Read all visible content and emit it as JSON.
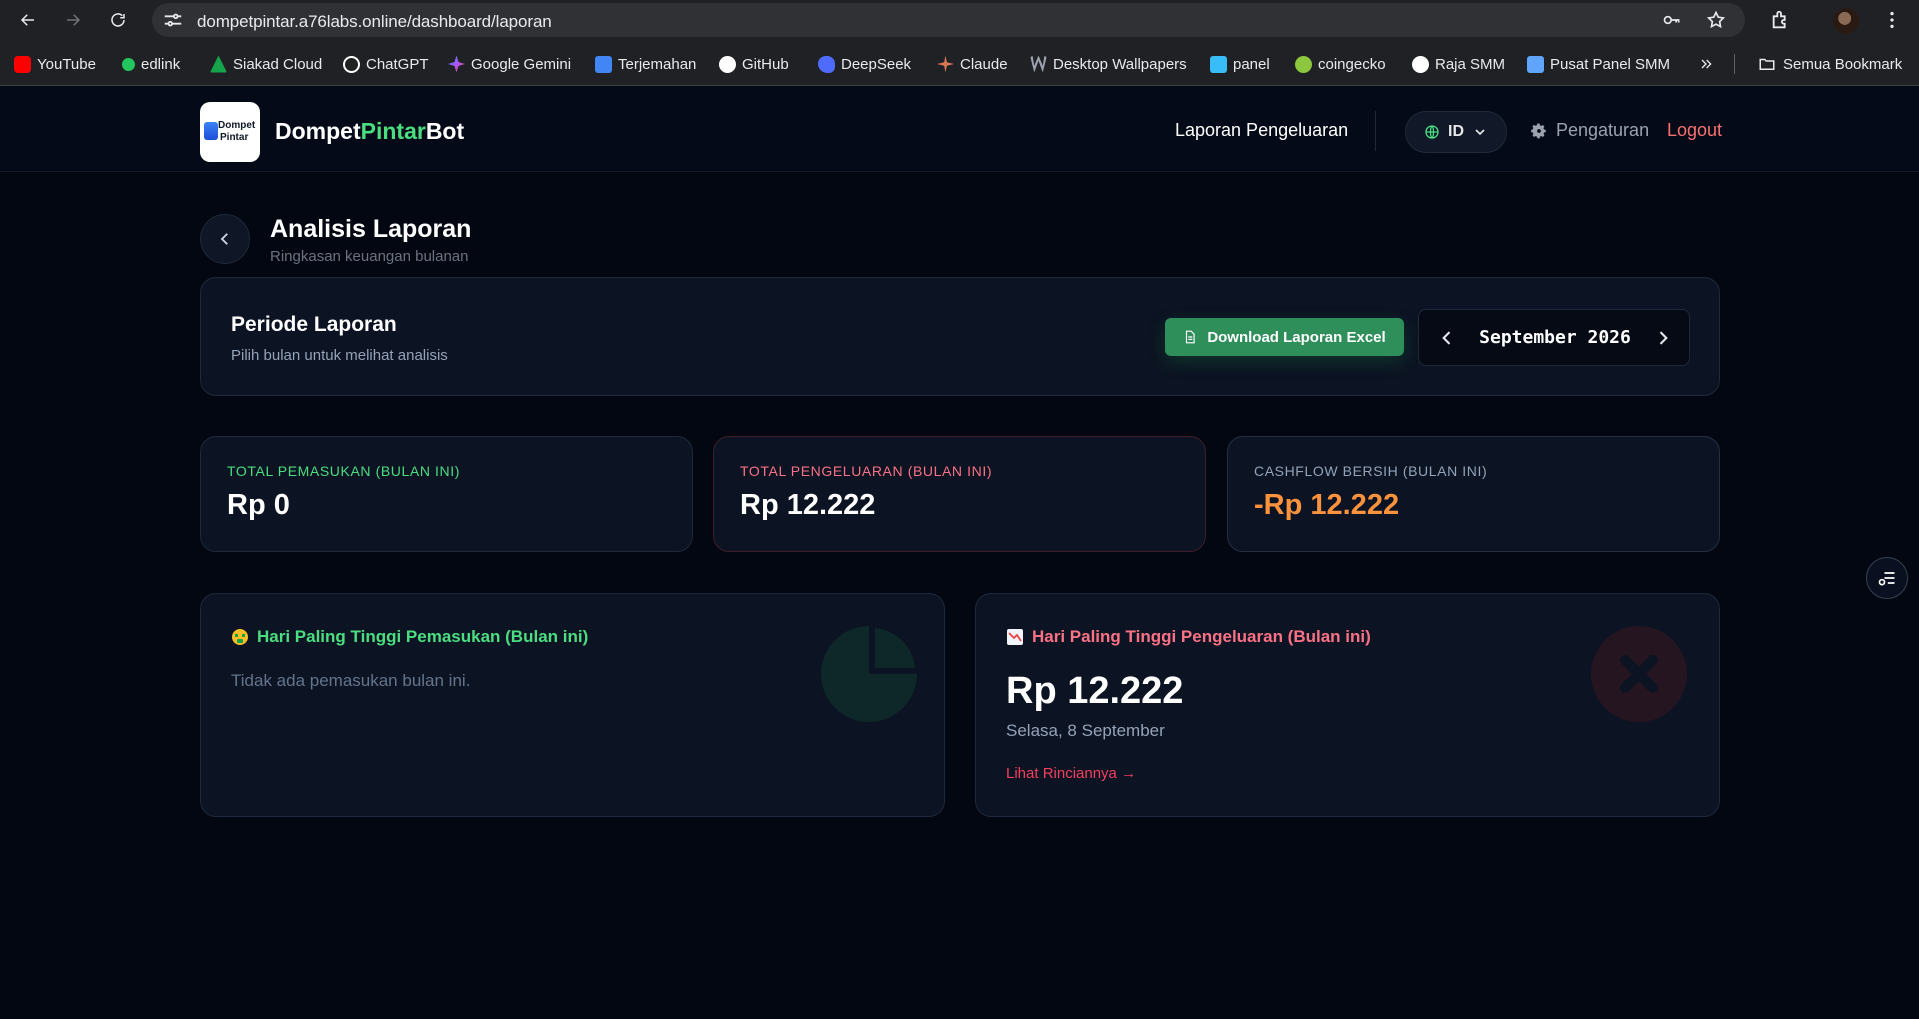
{
  "browser": {
    "url": "dompetpintar.a76labs.online/dashboard/laporan",
    "bookmarks": [
      {
        "label": "YouTube",
        "color": "#ff0000"
      },
      {
        "label": "edlink",
        "color": "#22c55e"
      },
      {
        "label": "Siakad Cloud",
        "color": "#16a34a"
      },
      {
        "label": "ChatGPT",
        "color": "#ffffff"
      },
      {
        "label": "Google Gemini",
        "color": "#8b5cf6"
      },
      {
        "label": "Terjemahan",
        "color": "#4285f4"
      },
      {
        "label": "GitHub",
        "color": "#ffffff"
      },
      {
        "label": "DeepSeek",
        "color": "#4f6bfe"
      },
      {
        "label": "Claude",
        "color": "#d97757"
      },
      {
        "label": "Desktop Wallpapers",
        "color": "#9ca3af"
      },
      {
        "label": "panel",
        "color": "#38bdf8"
      },
      {
        "label": "coingecko",
        "color": "#8dc63f"
      },
      {
        "label": "Raja SMM",
        "color": "#ffffff"
      },
      {
        "label": "Pusat Panel SMM",
        "color": "#60a5fa"
      }
    ],
    "all_bookmarks_label": "Semua Bookmark"
  },
  "header": {
    "brand_part1": "Dompet",
    "brand_part2": "Pintar",
    "brand_part3": "Bot",
    "logo_text_1": "Dompet",
    "logo_text_2": "Pintar",
    "nav_laporan": "Laporan Pengeluaran",
    "lang": "ID",
    "settings": "Pengaturan",
    "logout": "Logout"
  },
  "page": {
    "title": "Analisis Laporan",
    "subtitle": "Ringkasan keuangan bulanan"
  },
  "period": {
    "title": "Periode Laporan",
    "subtitle": "Pilih bulan untuk melihat analisis",
    "download_label": "Download Laporan Excel",
    "month_label": "September 2026"
  },
  "stats": {
    "income_label": "TOTAL PEMASUKAN (BULAN INI)",
    "income_value": "Rp 0",
    "expense_label": "TOTAL PENGELUARAN (BULAN INI)",
    "expense_value": "Rp 12.222",
    "cashflow_label": "CASHFLOW BERSIH (BULAN INI)",
    "cashflow_value": "-Rp 12.222"
  },
  "highlights": {
    "income_title": "Hari Paling Tinggi Pemasukan (Bulan ini)",
    "income_empty": "Tidak ada pemasukan bulan ini.",
    "expense_title": "Hari Paling Tinggi Pengeluaran (Bulan ini)",
    "expense_amount": "Rp 12.222",
    "expense_date": "Selasa, 8 September",
    "expense_link": "Lihat Rinciannya →"
  },
  "colors": {
    "income": "#4ade80",
    "expense": "#fb7185",
    "cashflow_negative": "#fb923c",
    "download_button": "#2f8f5b"
  }
}
